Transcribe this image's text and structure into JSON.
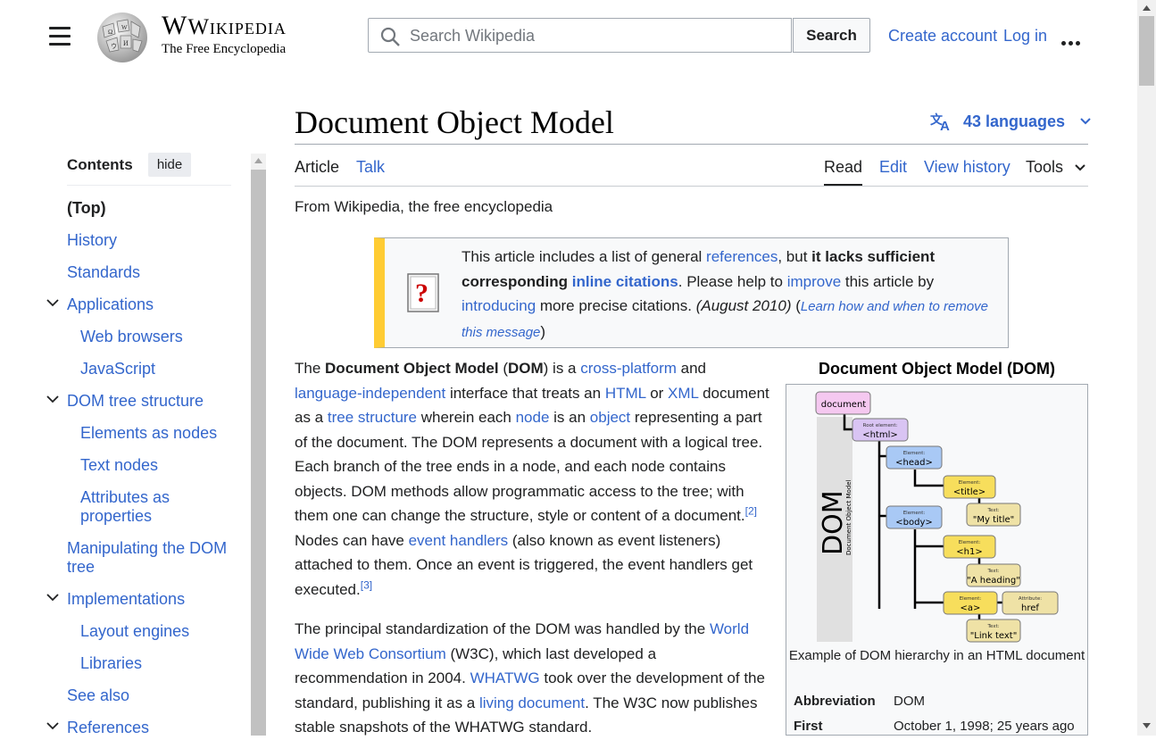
{
  "header": {
    "wordmark": "Wikipedia",
    "tagline": "The Free Encyclopedia",
    "search_placeholder": "Search Wikipedia",
    "search_button": "Search",
    "create_account": "Create account",
    "log_in": "Log in"
  },
  "page": {
    "title": "Document Object Model",
    "languages": "43 languages",
    "tabs": {
      "article": "Article",
      "talk": "Talk",
      "read": "Read",
      "edit": "Edit",
      "view_history": "View history",
      "tools": "Tools"
    },
    "from": "From Wikipedia, the free encyclopedia"
  },
  "ambox": {
    "t1": "This article includes a list of general ",
    "l1": "references",
    "t2": ", but ",
    "b1": "it lacks sufficient corresponding ",
    "l2": "inline citations",
    "t3": ". Please help to ",
    "l3": "improve",
    "t4": " this article by ",
    "l4": "introducing",
    "t5": " more precise citations. ",
    "date": "(August 2010)",
    "t6": " (",
    "l5": "Learn how and when to remove this message",
    "t7": ")"
  },
  "para1": {
    "s1": "The ",
    "b1": "Document Object Model",
    "s2": " (",
    "b2": "DOM",
    "s3": ") is a ",
    "l1": "cross-platform",
    "s4": " and ",
    "l2": "language-independent",
    "s5": " interface that treats an ",
    "l3": "HTML",
    "s6": " or ",
    "l4": "XML",
    "s7": " document as a ",
    "l5": "tree structure",
    "s8": " wherein each ",
    "l6": "node",
    "s9": " is an ",
    "l7": "object",
    "s10": " representing a part of the document. The DOM represents a document with a logical tree. Each branch of the tree ends in a node, and each node contains objects. DOM methods allow programmatic access to the tree; with them one can change the structure, style or content of a document.",
    "r1": "[2]",
    "s11": " Nodes can have ",
    "l8": "event handlers",
    "s12": " (also known as event listeners) attached to them. Once an event is triggered, the event handlers get executed.",
    "r2": "[3]"
  },
  "para2": {
    "s1": "The principal standardization of the DOM was handled by the ",
    "l1": "World Wide Web Consortium",
    "s2": " (W3C), which last developed a recommendation in 2004. ",
    "l2": "WHATWG",
    "s3": " took over the development of the standard, publishing it as a ",
    "l3": "living document",
    "s4": ". The W3C now publishes stable snapshots of the WHATWG standard."
  },
  "infobox": {
    "title": "Document Object Model (DOM)",
    "diagram": {
      "side_big": "DOM",
      "side_small": "Document Object Model",
      "document": "document",
      "root_label": "Root element:",
      "root": "<html>",
      "el_label": "Element:",
      "head": "<head>",
      "title": "<title>",
      "text_label": "Text:",
      "title_text": "\"My title\"",
      "body": "<body>",
      "h1": "<h1>",
      "h1_text": "\"A heading\"",
      "a": "<a>",
      "attr_label": "Attribute:",
      "href": "href",
      "a_text": "\"Link text\""
    },
    "caption": "Example of DOM hierarchy in an HTML document",
    "rows": [
      {
        "k": "Abbreviation",
        "v": "DOM"
      },
      {
        "k": "First",
        "v": "October 1, 1998; 25 years ago"
      }
    ]
  },
  "toc": {
    "heading": "Contents",
    "hide": "hide",
    "items": [
      {
        "label": "(Top)"
      },
      {
        "label": "History"
      },
      {
        "label": "Standards"
      },
      {
        "label": "Applications"
      },
      {
        "label": "Web browsers"
      },
      {
        "label": "JavaScript"
      },
      {
        "label": "DOM tree structure"
      },
      {
        "label": "Elements as nodes"
      },
      {
        "label": "Text nodes"
      },
      {
        "label": "Attributes as properties"
      },
      {
        "label": "Manipulating the DOM tree"
      },
      {
        "label": "Implementations"
      },
      {
        "label": "Layout engines"
      },
      {
        "label": "Libraries"
      },
      {
        "label": "See also"
      },
      {
        "label": "References"
      }
    ]
  }
}
